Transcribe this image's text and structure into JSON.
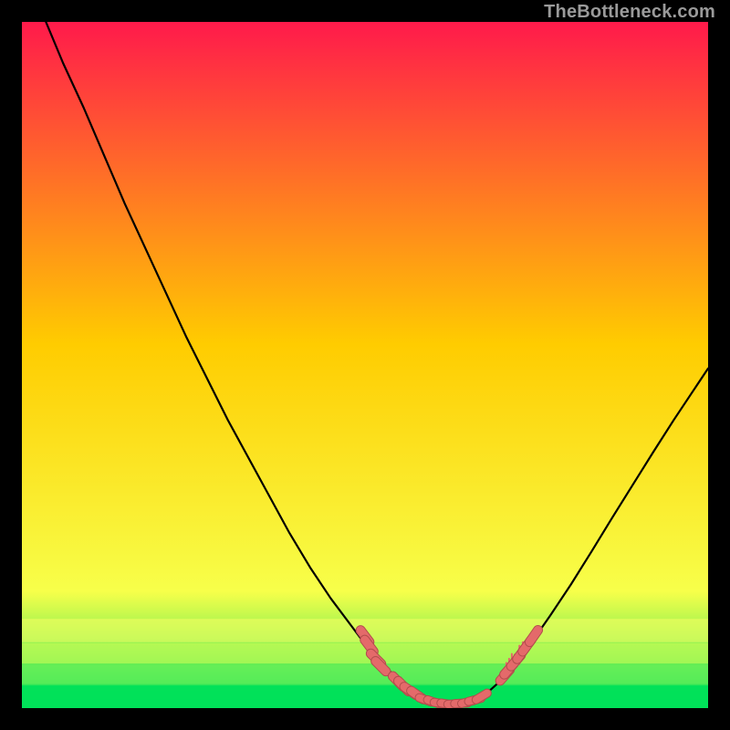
{
  "watermark": "TheBottleneck.com",
  "colors": {
    "page_bg": "#000000",
    "grad_top": "#ff1a4b",
    "grad_mid": "#ffcc00",
    "grad_low": "#f7ff4a",
    "grad_bottom": "#00e05a",
    "band1": "#faff62",
    "band2": "#d8ff55",
    "band3": "#6cf05a",
    "band4": "#00e05a",
    "curve": "#000000",
    "marker": "#e46a6a",
    "marker_stroke": "#b34d4d",
    "tick": "#e46a6a",
    "watermark": "#9a9a9a"
  },
  "chart_data": {
    "type": "line",
    "title": "",
    "xlabel": "",
    "ylabel": "",
    "xlim": [
      0,
      100
    ],
    "ylim": [
      0,
      100
    ],
    "grid": false,
    "legend": false,
    "curve": [
      {
        "x": 3.5,
        "y": 100.0
      },
      {
        "x": 6.0,
        "y": 94.0
      },
      {
        "x": 9.0,
        "y": 87.5
      },
      {
        "x": 12.0,
        "y": 80.5
      },
      {
        "x": 15.0,
        "y": 73.5
      },
      {
        "x": 18.0,
        "y": 67.0
      },
      {
        "x": 21.0,
        "y": 60.5
      },
      {
        "x": 24.0,
        "y": 54.0
      },
      {
        "x": 27.0,
        "y": 48.0
      },
      {
        "x": 30.0,
        "y": 42.0
      },
      {
        "x": 33.0,
        "y": 36.5
      },
      {
        "x": 36.0,
        "y": 31.0
      },
      {
        "x": 39.0,
        "y": 25.5
      },
      {
        "x": 42.0,
        "y": 20.5
      },
      {
        "x": 45.0,
        "y": 16.0
      },
      {
        "x": 48.0,
        "y": 12.0
      },
      {
        "x": 51.0,
        "y": 8.0
      },
      {
        "x": 54.0,
        "y": 5.0
      },
      {
        "x": 56.0,
        "y": 3.0
      },
      {
        "x": 58.0,
        "y": 1.6
      },
      {
        "x": 60.0,
        "y": 0.9
      },
      {
        "x": 62.0,
        "y": 0.6
      },
      {
        "x": 64.0,
        "y": 0.7
      },
      {
        "x": 66.0,
        "y": 1.2
      },
      {
        "x": 68.0,
        "y": 2.4
      },
      {
        "x": 70.0,
        "y": 4.2
      },
      {
        "x": 72.0,
        "y": 6.5
      },
      {
        "x": 74.0,
        "y": 9.2
      },
      {
        "x": 77.0,
        "y": 13.5
      },
      {
        "x": 80.0,
        "y": 18.0
      },
      {
        "x": 83.0,
        "y": 22.8
      },
      {
        "x": 86.0,
        "y": 27.7
      },
      {
        "x": 89.0,
        "y": 32.5
      },
      {
        "x": 92.0,
        "y": 37.3
      },
      {
        "x": 95.0,
        "y": 42.0
      },
      {
        "x": 98.0,
        "y": 46.5
      },
      {
        "x": 100.0,
        "y": 49.5
      }
    ],
    "markers_left": [
      {
        "x": 50.0,
        "y": 10.5
      },
      {
        "x": 50.6,
        "y": 9.1
      },
      {
        "x": 51.6,
        "y": 7.2
      },
      {
        "x": 52.3,
        "y": 6.1
      },
      {
        "x": 54.8,
        "y": 3.9
      },
      {
        "x": 55.6,
        "y": 3.2
      },
      {
        "x": 56.6,
        "y": 2.5
      },
      {
        "x": 57.6,
        "y": 1.9
      }
    ],
    "markers_bottom": [
      {
        "x": 58.8,
        "y": 1.2
      },
      {
        "x": 60.0,
        "y": 0.9
      },
      {
        "x": 61.0,
        "y": 0.7
      },
      {
        "x": 62.0,
        "y": 0.6
      },
      {
        "x": 63.0,
        "y": 0.6
      },
      {
        "x": 64.0,
        "y": 0.7
      },
      {
        "x": 65.0,
        "y": 0.9
      },
      {
        "x": 66.0,
        "y": 1.2
      },
      {
        "x": 67.0,
        "y": 1.7
      }
    ],
    "markers_right": [
      {
        "x": 70.4,
        "y": 4.8
      },
      {
        "x": 71.0,
        "y": 5.7
      },
      {
        "x": 72.0,
        "y": 6.9
      },
      {
        "x": 72.8,
        "y": 8.0
      },
      {
        "x": 73.6,
        "y": 9.1
      },
      {
        "x": 74.6,
        "y": 10.5
      }
    ],
    "ticks_right": [
      {
        "x": 70.2,
        "y0": 3.8,
        "y1": 5.2
      },
      {
        "x": 70.6,
        "y0": 4.2,
        "y1": 6.6
      },
      {
        "x": 71.0,
        "y0": 4.8,
        "y1": 7.2
      },
      {
        "x": 71.4,
        "y0": 5.2,
        "y1": 7.9
      },
      {
        "x": 71.8,
        "y0": 5.8,
        "y1": 7.8
      },
      {
        "x": 72.5,
        "y0": 6.4,
        "y1": 9.1
      },
      {
        "x": 73.0,
        "y0": 7.2,
        "y1": 9.6
      }
    ]
  }
}
